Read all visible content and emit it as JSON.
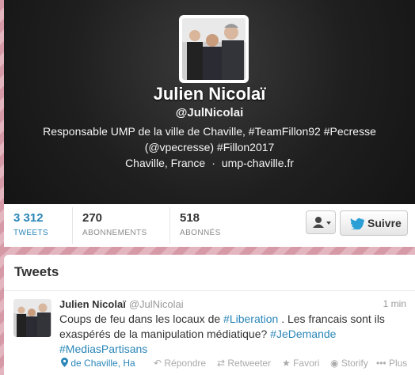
{
  "profile": {
    "name": "Julien Nicolaï",
    "handle": "@JulNicolai",
    "bio": "Responsable UMP de la ville de Chaville, #TeamFillon92 #Pecresse (@vpecresse) #Fillon2017",
    "location": "Chaville, France",
    "separator": "·",
    "website": "ump-chaville.fr"
  },
  "stats": [
    {
      "value": "3 312",
      "label": "TWEETS"
    },
    {
      "value": "270",
      "label": "ABONNEMENTS"
    },
    {
      "value": "518",
      "label": "ABONNÉS"
    }
  ],
  "buttons": {
    "follow_label": "Suivre"
  },
  "tweets_section": {
    "title": "Tweets"
  },
  "tweet": {
    "name": "Julien Nicolaï",
    "handle": "@JulNicolai",
    "time": "1 min",
    "text_part1": "Coups de feu dans les locaux de ",
    "tag1": "#Liberation",
    "text_part2": " . Les francais sont ils exaspérés de la manipulation médiatique? ",
    "tag2": "#JeDemande",
    "tag3": "#MediasPartisans",
    "place": "de Chaville, Ha",
    "actions": {
      "reply": "Répondre",
      "retweet": "Retweeter",
      "favorite": "Favori",
      "storify": "Storify",
      "more": "Plus"
    }
  },
  "colors": {
    "link": "#2a86b8",
    "header_bg": "#1f1f1f",
    "pink_bg": "#d69aa7"
  }
}
